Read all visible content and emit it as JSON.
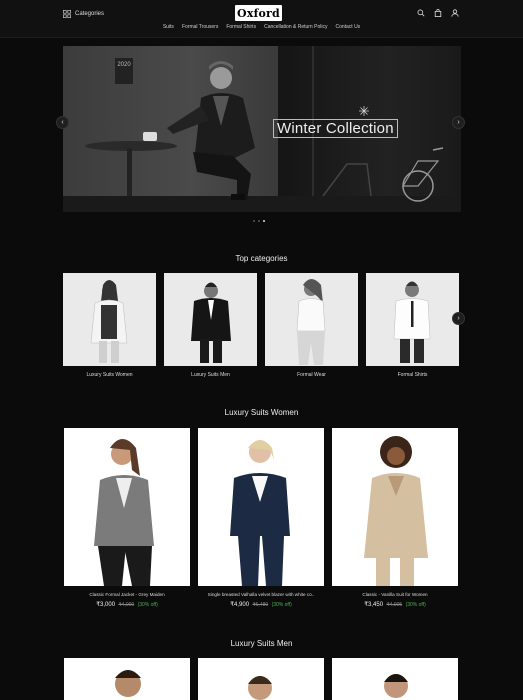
{
  "header": {
    "categories_label": "Categories",
    "logo": "Oxford",
    "nav": [
      "Suits",
      "Formal Trousers",
      "Formal Shirts",
      "Cancellation & Return Policy",
      "Contact Us"
    ],
    "icons": [
      "search-icon",
      "bag-icon",
      "user-icon"
    ]
  },
  "hero": {
    "title": "Winter Collection",
    "poster_text": "2020",
    "prev": "‹",
    "next": "›",
    "slides": 3,
    "active_slide": 3
  },
  "top_categories": {
    "title": "Top categories",
    "items": [
      {
        "label": "Luxury Suits Women"
      },
      {
        "label": "Luxury Suits Men"
      },
      {
        "label": "Formal Wear"
      },
      {
        "label": "Formal Shirts"
      }
    ],
    "next": "›"
  },
  "women_section": {
    "title": "Luxury Suits Women",
    "products": [
      {
        "name": "Classic Formal Jacket - Grey Maiden",
        "price": "₹3,000",
        "was": "₹4,000",
        "off": "(30% off)"
      },
      {
        "name": "Single breasted Valhalla velvet blazer with white co..",
        "price": "₹4,900",
        "was": "₹6,480",
        "off": "(30% off)"
      },
      {
        "name": "Classic - Vanilla Suit for Women",
        "price": "₹3,450",
        "was": "₹4,905",
        "off": "(30% off)"
      }
    ]
  },
  "men_section": {
    "title": "Luxury Suits Men"
  },
  "colors": {
    "background": "#0b0b0b",
    "discount": "#4caf50"
  }
}
